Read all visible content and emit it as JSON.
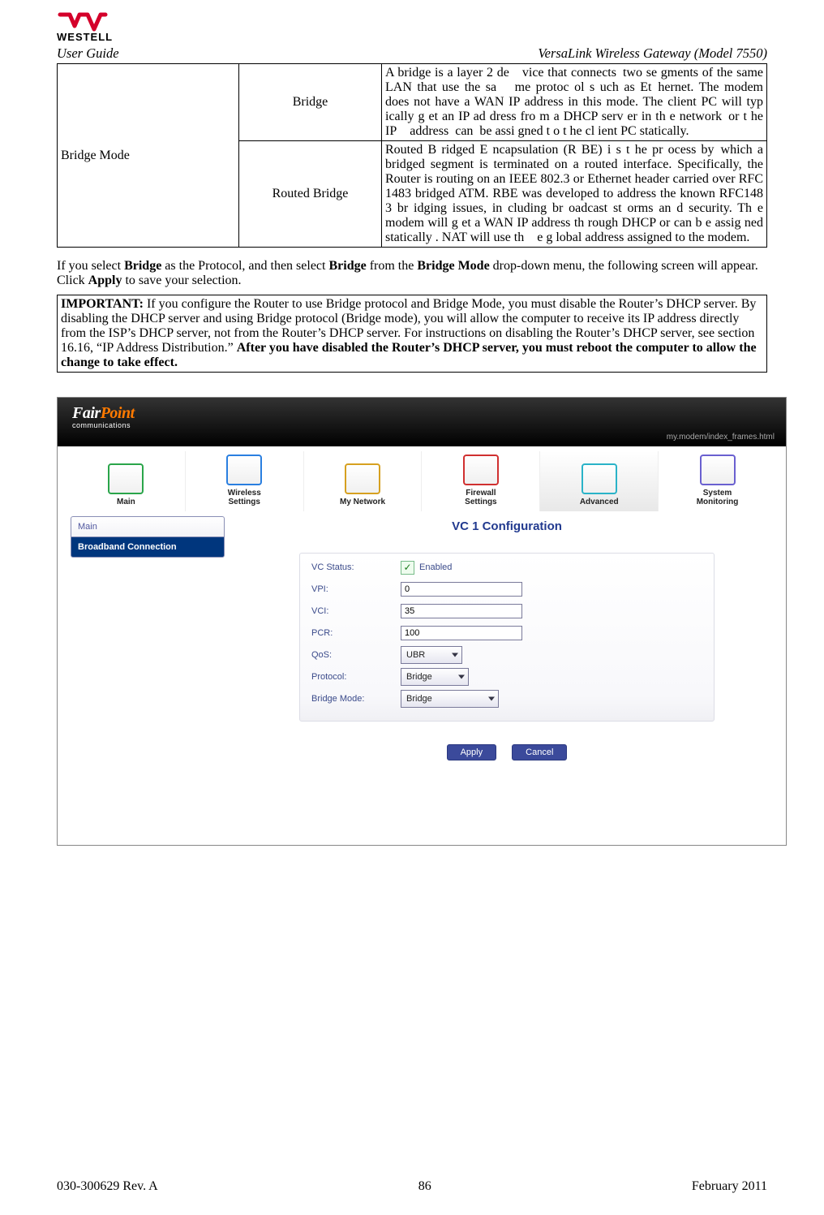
{
  "header": {
    "brand": "WESTELL",
    "left": "User Guide",
    "right": "VersaLink Wireless Gateway (Model 7550)"
  },
  "mode_table": {
    "group_label": "Bridge Mode",
    "rows": [
      {
        "name": "Bridge",
        "desc": "A bridge is a layer 2 de vice that connects two se gments of the same LAN that use the sa  me protoc ol s uch as Et hernet. The modem does not have a WAN IP address in this mode. The client PC will typ ically g et an IP ad dress fro m a DHCP serv er in th e network or t he IP address can be assi gned t o t he cl ient PC statically."
      },
      {
        "name": "Routed Bridge",
        "desc": "Routed B ridged E ncapsulation (R BE) i s t he pr ocess by which a bridged segment is terminated on a routed interface. Specifically, the Router is routing on an IEEE 802.3 or Ethernet header carried over RFC 1483 bridged ATM. RBE was developed to address the known RFC148 3 br idging issues, in cluding br oadcast st orms an d security. Th e modem will g et a WAN IP address th rough DHCP or can b e assig ned statically . NAT will use th e g lobal address assigned to the modem."
      }
    ]
  },
  "paragraph": {
    "pre1": "If you select ",
    "b1": "Bridge",
    "mid1": " as the Protocol, and then select ",
    "b2": "Bridge",
    "mid2": " from the ",
    "b3": "Bridge Mode",
    "mid3": " drop-down menu, the following screen will appear. Click ",
    "b4": "Apply",
    "post": " to save your selection."
  },
  "important": {
    "label": "IMPORTANT:",
    "body": " If you configure the Router to use Bridge protocol and Bridge Mode, you must disable the Router’s DHCP server. By disabling the DHCP server and using Bridge protocol (Bridge mode), you will allow the computer to receive its IP address directly from the ISP’s DHCP server, not from the Router’s DHCP server. For instructions on disabling the Router’s DHCP server, see section 16.16, “IP Address Distribution.” ",
    "bold_tail": "After you have disabled the Router’s DHCP server, you must reboot the computer to allow the change to take effect."
  },
  "screenshot": {
    "brand_main": "Fair",
    "brand_accent": "Point",
    "brand_sub": "communications",
    "url": "my.modem/index_frames.html",
    "tabs": [
      {
        "label": "Main",
        "color": "#2aa54a"
      },
      {
        "label": "Wireless\nSettings",
        "color": "#2a7fe0"
      },
      {
        "label": "My Network",
        "color": "#d6a020"
      },
      {
        "label": "Firewall\nSettings",
        "color": "#d03030"
      },
      {
        "label": "Advanced",
        "color": "#2ab3c8"
      },
      {
        "label": "System\nMonitoring",
        "color": "#6a60d0"
      }
    ],
    "sidebar": [
      {
        "label": "Main",
        "selected": false
      },
      {
        "label": "Broadband Connection",
        "selected": true
      }
    ],
    "panel_title": "VC 1 Configuration",
    "fields": {
      "status_label": "VC Status:",
      "status_value": "Enabled",
      "vpi_label": "VPI:",
      "vpi_value": "0",
      "vci_label": "VCI:",
      "vci_value": "35",
      "pcr_label": "PCR:",
      "pcr_value": "100",
      "qos_label": "QoS:",
      "qos_value": "UBR",
      "protocol_label": "Protocol:",
      "protocol_value": "Bridge",
      "bmode_label": "Bridge Mode:",
      "bmode_value": "Bridge"
    },
    "buttons": {
      "apply": "Apply",
      "cancel": "Cancel"
    }
  },
  "footer": {
    "left": "030-300629 Rev. A",
    "center": "86",
    "right": "February 2011"
  }
}
